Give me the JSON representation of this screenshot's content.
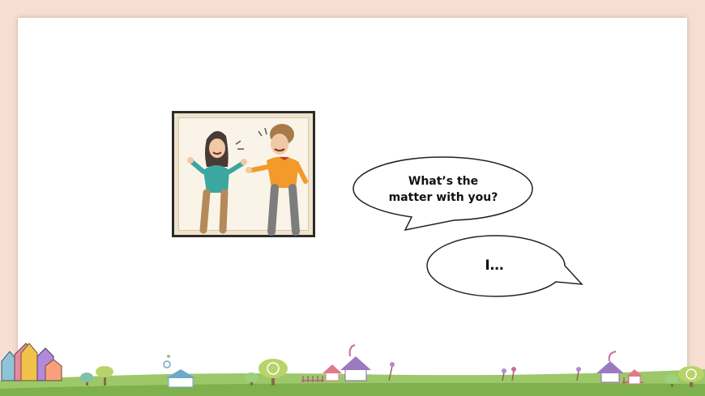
{
  "speech": {
    "question_line1": "What’s the",
    "question_line2": "matter with you?",
    "answer": "I…"
  },
  "colors": {
    "background": "#f6dfd2",
    "slide": "#ffffff",
    "ground": "#9dc86a",
    "frame_border": "#2b2b2b"
  },
  "picture": {
    "description_icon": "arguing-couple-illustration"
  },
  "decoration": {
    "icon": "pencils-and-village-border"
  }
}
